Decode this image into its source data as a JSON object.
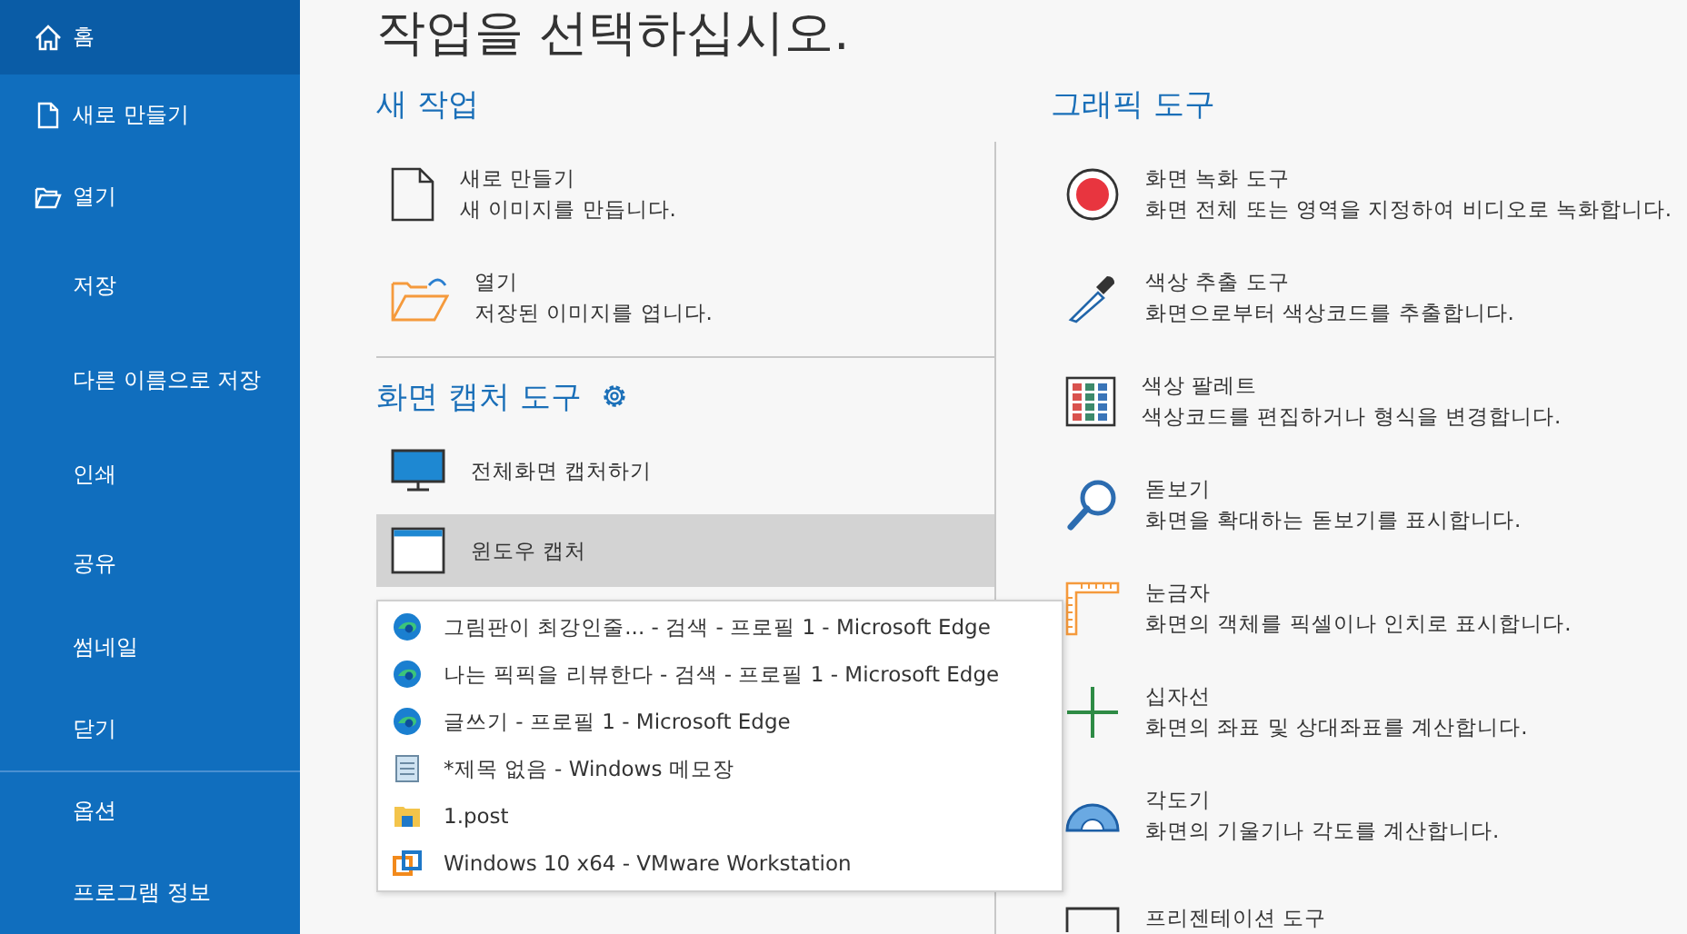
{
  "sidebar": {
    "items": [
      {
        "label": "홈",
        "selected": true
      },
      {
        "label": "새로 만들기",
        "selected": false
      },
      {
        "label": "열기",
        "selected": false
      },
      {
        "label": "저장",
        "selected": false
      },
      {
        "label": "다른 이름으로 저장",
        "selected": false
      },
      {
        "label": "인쇄",
        "selected": false
      },
      {
        "label": "공유",
        "selected": false
      },
      {
        "label": "썸네일",
        "selected": false
      },
      {
        "label": "닫기",
        "selected": false
      },
      {
        "label": "옵션",
        "selected": false
      },
      {
        "label": "프로그램 정보",
        "selected": false
      }
    ]
  },
  "title": "작업을 선택하십시오.",
  "new_task": {
    "heading": "새 작업",
    "items": [
      {
        "title": "새로 만들기",
        "description": "새 이미지를 만듭니다."
      },
      {
        "title": "열기",
        "description": "저장된 이미지를 엽니다."
      }
    ]
  },
  "capture_tools": {
    "heading": "화면 캡처 도구",
    "items": [
      {
        "label": "전체화면 캡처하기",
        "selected": false
      },
      {
        "label": "윈도우 캡처",
        "selected": true
      }
    ]
  },
  "window_menu": {
    "items": [
      {
        "label": "그림판이 최강인줄... - 검색 - 프로필 1 - Microsoft Edge"
      },
      {
        "label": "나는 픽픽을 리뷰한다 - 검색 - 프로필 1 - Microsoft Edge"
      },
      {
        "label": "글쓰기 - 프로필 1 - Microsoft Edge"
      },
      {
        "label": "*제목 없음 - Windows 메모장"
      },
      {
        "label": "1.post"
      },
      {
        "label": "Windows 10 x64 - VMware Workstation"
      }
    ]
  },
  "graphic_tools": {
    "heading": "그래픽 도구",
    "items": [
      {
        "title": "화면 녹화 도구",
        "description": "화면 전체 또는 영역을 지정하여 비디오로 녹화합니다."
      },
      {
        "title": "색상 추출 도구",
        "description": "화면으로부터 색상코드를 추출합니다."
      },
      {
        "title": "색상 팔레트",
        "description": "색상코드를 편집하거나 형식을 변경합니다."
      },
      {
        "title": "돋보기",
        "description": "화면을 확대하는 돋보기를 표시합니다."
      },
      {
        "title": "눈금자",
        "description": "화면의 객체를 픽셀이나 인치로 표시합니다."
      },
      {
        "title": "십자선",
        "description": "화면의 좌표 및 상대좌표를 계산합니다."
      },
      {
        "title": "각도기",
        "description": "화면의 기울기나 각도를 계산합니다."
      },
      {
        "title": "프리젠테이션 도구"
      }
    ]
  }
}
